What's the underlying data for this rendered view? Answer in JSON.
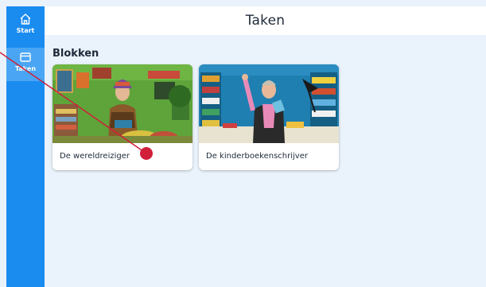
{
  "sidebar": {
    "items": [
      {
        "label": "Start",
        "icon": "home-icon"
      },
      {
        "label": "Taken",
        "icon": "tasks-icon",
        "active": true
      }
    ]
  },
  "header": {
    "title": "Taken"
  },
  "section": {
    "title": "Blokken",
    "cards": [
      {
        "label": "De wereldreiziger",
        "image": "traveler-photo"
      },
      {
        "label": "De kinderboekenschrijver",
        "image": "author-photo"
      }
    ]
  },
  "colors": {
    "sidebar": "#1a8cf0",
    "sidebar_active": "#4aa6f5",
    "background": "#eaf2fb",
    "pointer": "#d0203a"
  }
}
